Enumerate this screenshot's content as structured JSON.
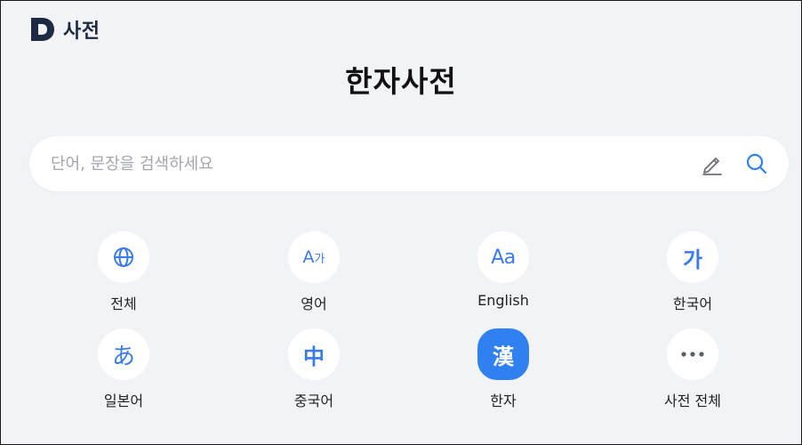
{
  "header": {
    "logo_letter": "D",
    "logo_text": "사전"
  },
  "page": {
    "title": "한자사전"
  },
  "search": {
    "placeholder": "단어, 문장을 검색하세요",
    "value": ""
  },
  "colors": {
    "accent": "#2f80f0",
    "icon_blue": "#3a7bea",
    "logo_navy": "#1c2a44",
    "background": "#f2f3f7"
  },
  "categories": [
    {
      "label": "전체",
      "icon": "globe-icon",
      "glyph": ""
    },
    {
      "label": "영어",
      "icon": "a-ga-icon",
      "glyph": "A",
      "glyph_small": "가"
    },
    {
      "label": "English",
      "icon": "aa-icon",
      "glyph": "Aa"
    },
    {
      "label": "한국어",
      "icon": "ga-icon",
      "glyph": "가"
    },
    {
      "label": "일본어",
      "icon": "hiragana-a-icon",
      "glyph": "あ"
    },
    {
      "label": "중국어",
      "icon": "zhong-icon",
      "glyph": "中"
    },
    {
      "label": "한자",
      "icon": "han-icon",
      "glyph": "漢",
      "selected": true
    },
    {
      "label": "사전 전체",
      "icon": "more-icon",
      "glyph": ""
    }
  ]
}
